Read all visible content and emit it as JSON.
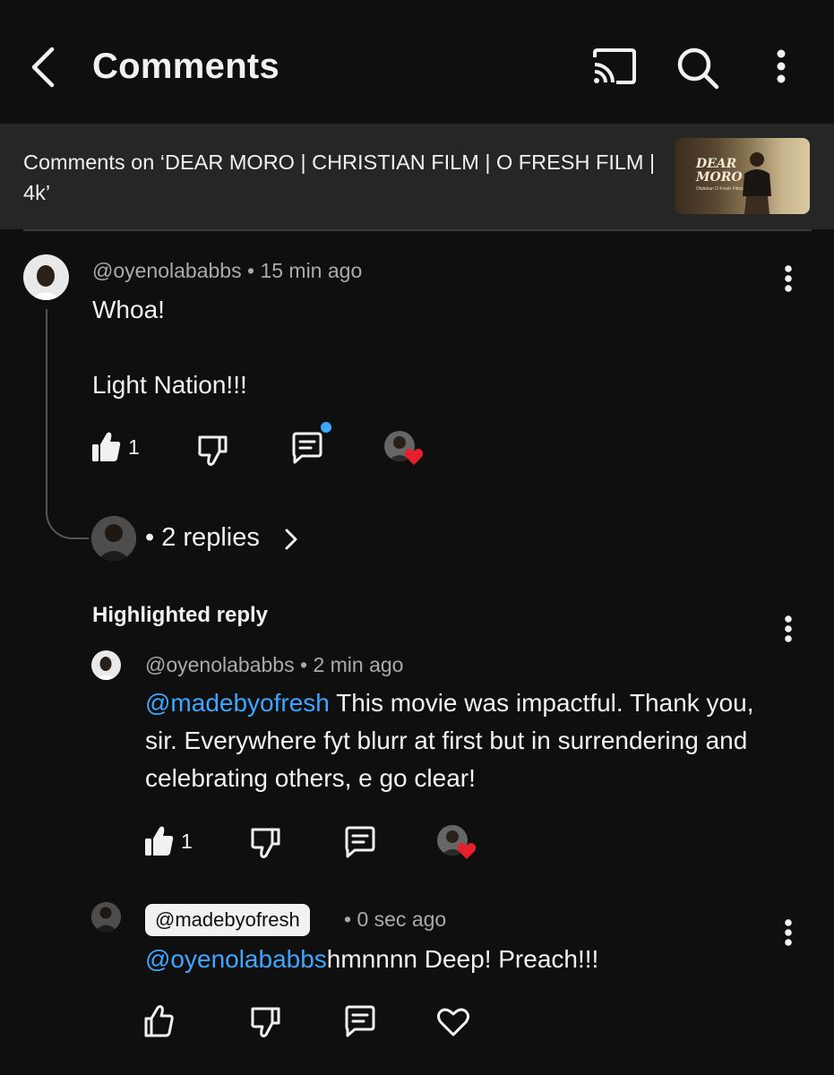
{
  "header": {
    "title": "Comments",
    "icons": [
      "back-arrow-icon",
      "cast-icon",
      "search-icon",
      "more-vert-icon"
    ]
  },
  "video": {
    "caption": "Comments on ‘DEAR MORO | CHRISTIAN FILM  | O FRESH FILM | 4k’",
    "thumbnail_title_line1": "DEAR",
    "thumbnail_title_line2": "MORO",
    "thumbnail_subtitle": "Olalekan O Fresh Films"
  },
  "comment": {
    "author": "@oyenolababbs",
    "time": "15 min ago",
    "text_line1": "Whoa!",
    "text_line2": "Light Nation!!!",
    "likes": "1",
    "replies_label": "2 replies"
  },
  "highlighted": {
    "label": "Highlighted reply",
    "author": "@oyenolababbs",
    "time": "2 min ago",
    "mention": "@madebyofresh",
    "text": " This movie was impactful. Thank you, sir. Everywhere fyt blurr at first but in surrendering and celebrating others, e go clear!",
    "likes": "1"
  },
  "reply2": {
    "author": "@madebyofresh",
    "time": "0 sec ago",
    "mention": "@oyenolababbs",
    "text": "hmnnnn Deep! Preach!!!"
  },
  "colors": {
    "background": "#0f0f0f",
    "banner": "#262626",
    "mention": "#3ea6ff",
    "heart": "#e3202b",
    "meta_text": "#aaaaaa"
  }
}
